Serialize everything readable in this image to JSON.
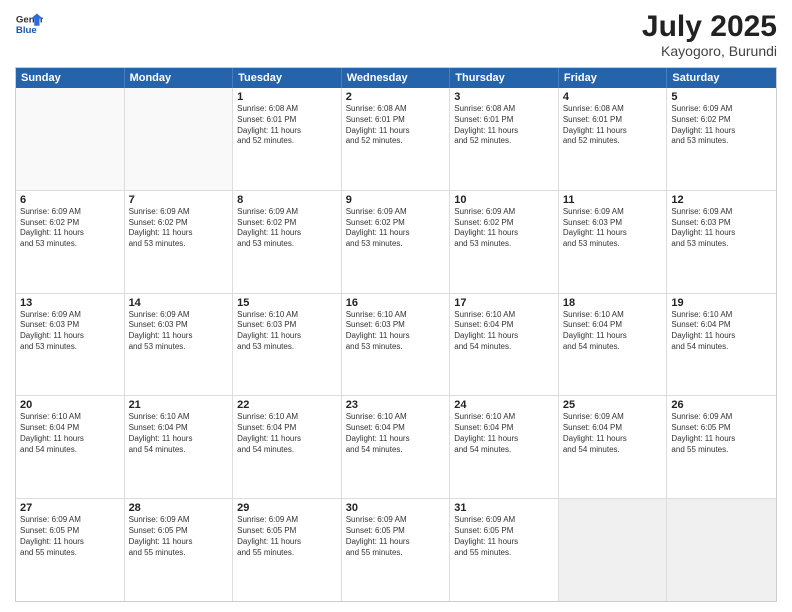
{
  "logo": {
    "general": "General",
    "blue": "Blue"
  },
  "header": {
    "month": "July 2025",
    "location": "Kayogoro, Burundi"
  },
  "weekdays": [
    "Sunday",
    "Monday",
    "Tuesday",
    "Wednesday",
    "Thursday",
    "Friday",
    "Saturday"
  ],
  "weeks": [
    [
      {
        "day": "",
        "info": ""
      },
      {
        "day": "",
        "info": ""
      },
      {
        "day": "1",
        "info": "Sunrise: 6:08 AM\nSunset: 6:01 PM\nDaylight: 11 hours\nand 52 minutes."
      },
      {
        "day": "2",
        "info": "Sunrise: 6:08 AM\nSunset: 6:01 PM\nDaylight: 11 hours\nand 52 minutes."
      },
      {
        "day": "3",
        "info": "Sunrise: 6:08 AM\nSunset: 6:01 PM\nDaylight: 11 hours\nand 52 minutes."
      },
      {
        "day": "4",
        "info": "Sunrise: 6:08 AM\nSunset: 6:01 PM\nDaylight: 11 hours\nand 52 minutes."
      },
      {
        "day": "5",
        "info": "Sunrise: 6:09 AM\nSunset: 6:02 PM\nDaylight: 11 hours\nand 53 minutes."
      }
    ],
    [
      {
        "day": "6",
        "info": "Sunrise: 6:09 AM\nSunset: 6:02 PM\nDaylight: 11 hours\nand 53 minutes."
      },
      {
        "day": "7",
        "info": "Sunrise: 6:09 AM\nSunset: 6:02 PM\nDaylight: 11 hours\nand 53 minutes."
      },
      {
        "day": "8",
        "info": "Sunrise: 6:09 AM\nSunset: 6:02 PM\nDaylight: 11 hours\nand 53 minutes."
      },
      {
        "day": "9",
        "info": "Sunrise: 6:09 AM\nSunset: 6:02 PM\nDaylight: 11 hours\nand 53 minutes."
      },
      {
        "day": "10",
        "info": "Sunrise: 6:09 AM\nSunset: 6:02 PM\nDaylight: 11 hours\nand 53 minutes."
      },
      {
        "day": "11",
        "info": "Sunrise: 6:09 AM\nSunset: 6:03 PM\nDaylight: 11 hours\nand 53 minutes."
      },
      {
        "day": "12",
        "info": "Sunrise: 6:09 AM\nSunset: 6:03 PM\nDaylight: 11 hours\nand 53 minutes."
      }
    ],
    [
      {
        "day": "13",
        "info": "Sunrise: 6:09 AM\nSunset: 6:03 PM\nDaylight: 11 hours\nand 53 minutes."
      },
      {
        "day": "14",
        "info": "Sunrise: 6:09 AM\nSunset: 6:03 PM\nDaylight: 11 hours\nand 53 minutes."
      },
      {
        "day": "15",
        "info": "Sunrise: 6:10 AM\nSunset: 6:03 PM\nDaylight: 11 hours\nand 53 minutes."
      },
      {
        "day": "16",
        "info": "Sunrise: 6:10 AM\nSunset: 6:03 PM\nDaylight: 11 hours\nand 53 minutes."
      },
      {
        "day": "17",
        "info": "Sunrise: 6:10 AM\nSunset: 6:04 PM\nDaylight: 11 hours\nand 54 minutes."
      },
      {
        "day": "18",
        "info": "Sunrise: 6:10 AM\nSunset: 6:04 PM\nDaylight: 11 hours\nand 54 minutes."
      },
      {
        "day": "19",
        "info": "Sunrise: 6:10 AM\nSunset: 6:04 PM\nDaylight: 11 hours\nand 54 minutes."
      }
    ],
    [
      {
        "day": "20",
        "info": "Sunrise: 6:10 AM\nSunset: 6:04 PM\nDaylight: 11 hours\nand 54 minutes."
      },
      {
        "day": "21",
        "info": "Sunrise: 6:10 AM\nSunset: 6:04 PM\nDaylight: 11 hours\nand 54 minutes."
      },
      {
        "day": "22",
        "info": "Sunrise: 6:10 AM\nSunset: 6:04 PM\nDaylight: 11 hours\nand 54 minutes."
      },
      {
        "day": "23",
        "info": "Sunrise: 6:10 AM\nSunset: 6:04 PM\nDaylight: 11 hours\nand 54 minutes."
      },
      {
        "day": "24",
        "info": "Sunrise: 6:10 AM\nSunset: 6:04 PM\nDaylight: 11 hours\nand 54 minutes."
      },
      {
        "day": "25",
        "info": "Sunrise: 6:09 AM\nSunset: 6:04 PM\nDaylight: 11 hours\nand 54 minutes."
      },
      {
        "day": "26",
        "info": "Sunrise: 6:09 AM\nSunset: 6:05 PM\nDaylight: 11 hours\nand 55 minutes."
      }
    ],
    [
      {
        "day": "27",
        "info": "Sunrise: 6:09 AM\nSunset: 6:05 PM\nDaylight: 11 hours\nand 55 minutes."
      },
      {
        "day": "28",
        "info": "Sunrise: 6:09 AM\nSunset: 6:05 PM\nDaylight: 11 hours\nand 55 minutes."
      },
      {
        "day": "29",
        "info": "Sunrise: 6:09 AM\nSunset: 6:05 PM\nDaylight: 11 hours\nand 55 minutes."
      },
      {
        "day": "30",
        "info": "Sunrise: 6:09 AM\nSunset: 6:05 PM\nDaylight: 11 hours\nand 55 minutes."
      },
      {
        "day": "31",
        "info": "Sunrise: 6:09 AM\nSunset: 6:05 PM\nDaylight: 11 hours\nand 55 minutes."
      },
      {
        "day": "",
        "info": ""
      },
      {
        "day": "",
        "info": ""
      }
    ]
  ]
}
